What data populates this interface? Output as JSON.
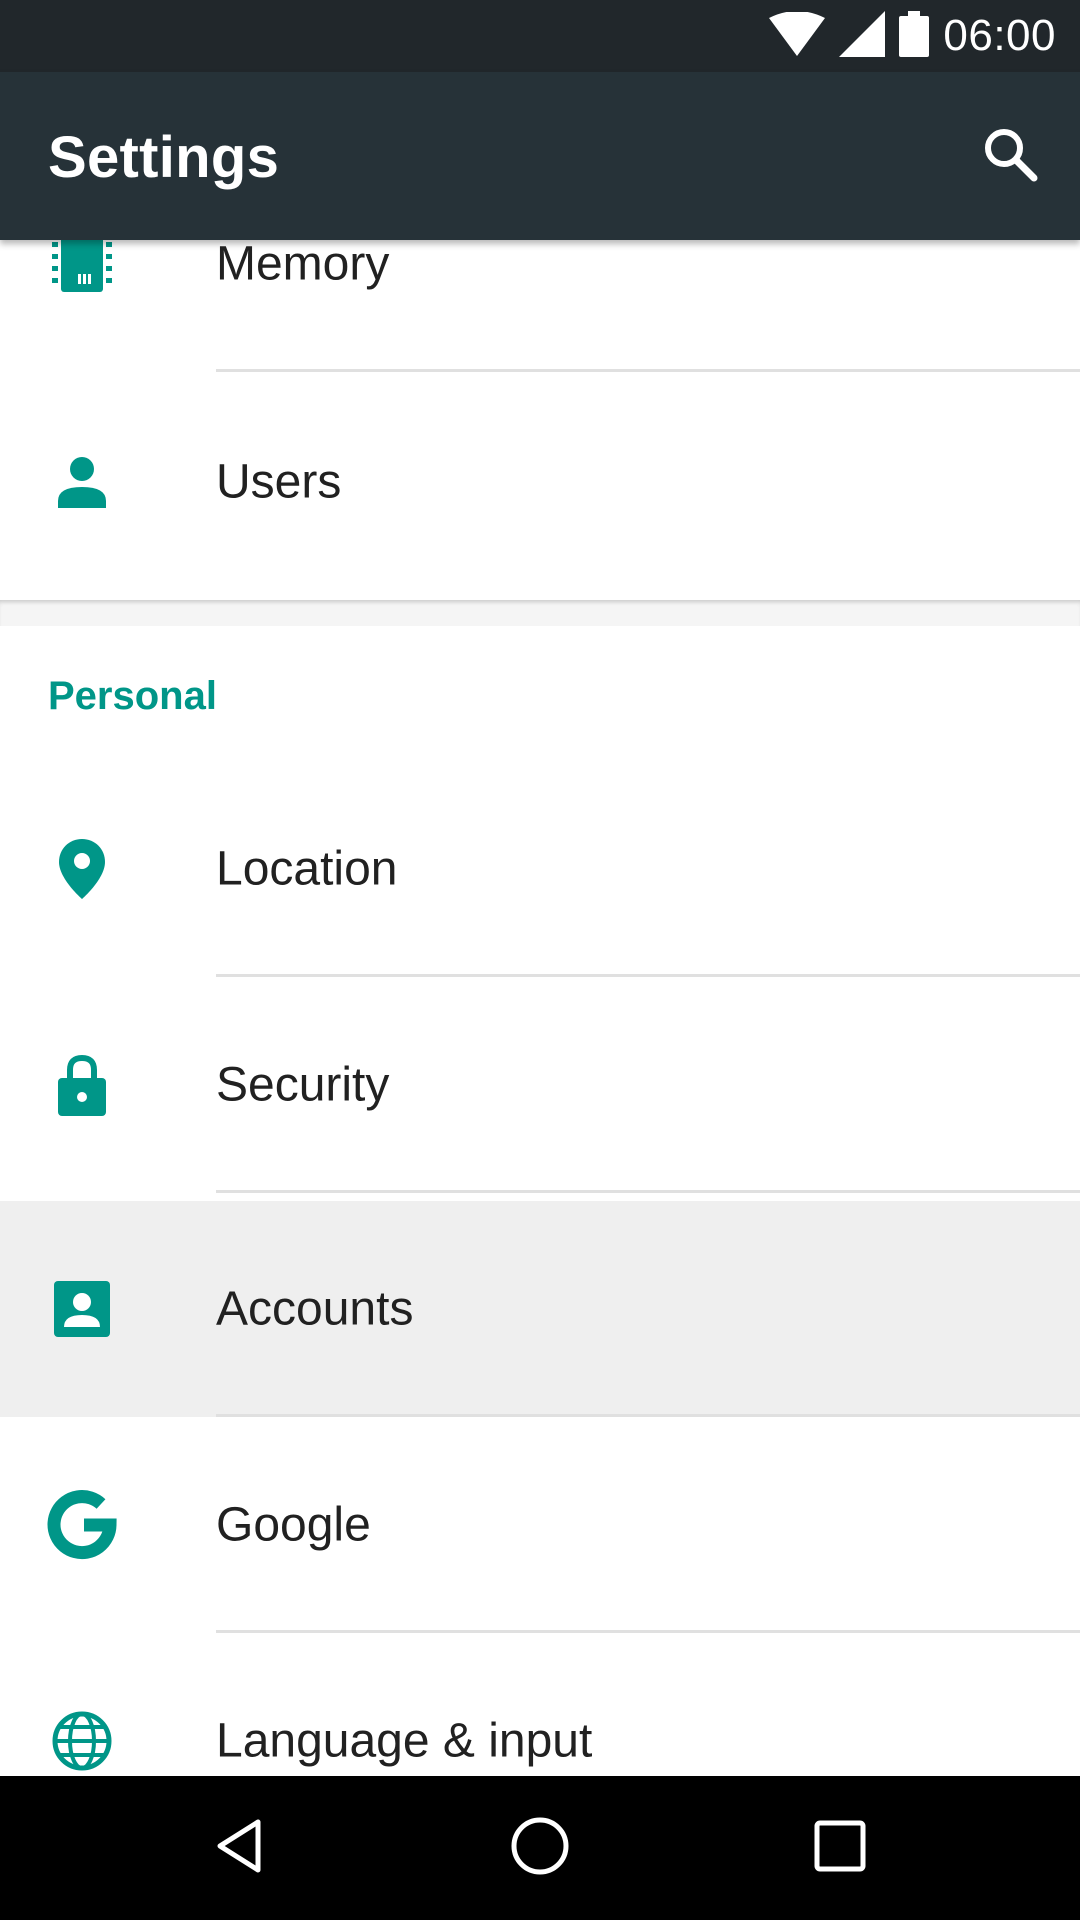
{
  "status_bar": {
    "time": "06:00",
    "icons": [
      "wifi-icon",
      "cellular-signal-icon",
      "battery-icon"
    ]
  },
  "app_bar": {
    "title": "Settings",
    "search_icon": "search-icon"
  },
  "colors": {
    "accent": "#009688",
    "app_bar": "#263238",
    "status_bar": "#21272b"
  },
  "device_section": {
    "items": [
      {
        "label": "Memory",
        "icon": "memory-chip-icon"
      },
      {
        "label": "Users",
        "icon": "person-icon"
      }
    ]
  },
  "personal_section": {
    "header": "Personal",
    "items": [
      {
        "label": "Location",
        "icon": "location-pin-icon"
      },
      {
        "label": "Security",
        "icon": "lock-icon"
      },
      {
        "label": "Accounts",
        "icon": "account-box-icon"
      },
      {
        "label": "Google",
        "icon": "google-g-icon"
      },
      {
        "label": "Language & input",
        "icon": "globe-icon"
      }
    ]
  },
  "nav_bar": {
    "buttons": [
      "back-icon",
      "home-icon",
      "recents-icon"
    ]
  }
}
